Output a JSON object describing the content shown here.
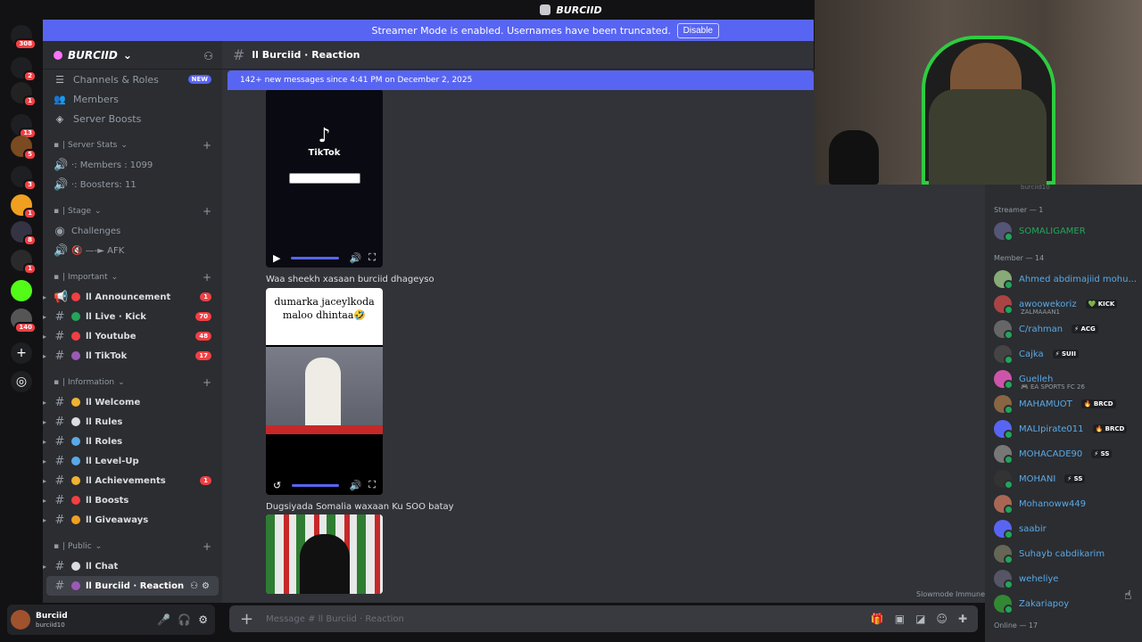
{
  "window": {
    "title": "BURCIID"
  },
  "rail": {
    "items": [
      {
        "badge": "308",
        "color": "#1e1f22"
      },
      {
        "badge": "2",
        "color": "#1e1f22"
      },
      {
        "badge": "1",
        "color": "#222"
      },
      {
        "badge": "13",
        "color": "#1e1f22"
      },
      {
        "badge": "5",
        "color": "#7a4a20"
      },
      {
        "badge": "3",
        "color": "#1e1f22"
      },
      {
        "badge": "1",
        "color": "#f0a020"
      },
      {
        "badge": "8",
        "color": "#334"
      },
      {
        "badge": "1",
        "color": "#2a2a2a"
      },
      {
        "badge": "",
        "color": "#53fc18"
      },
      {
        "badge": "140",
        "color": "#555"
      }
    ]
  },
  "banner": {
    "text": "Streamer Mode is enabled. Usernames have been truncated.",
    "button": "Disable"
  },
  "server": {
    "name": "BURCIID"
  },
  "nav": [
    {
      "icon": "channels-roles-icon",
      "glyph": "☰",
      "label": "Channels & Roles",
      "badge": "NEW"
    },
    {
      "icon": "members-icon",
      "glyph": "👥",
      "label": "Members",
      "badge": ""
    },
    {
      "icon": "server-boosts-icon",
      "glyph": "◈",
      "label": "Server Boosts",
      "badge": ""
    }
  ],
  "categories": [
    {
      "label": "| Server Stats",
      "channels": [
        {
          "type": "voice",
          "label": "·: Members : 1099",
          "badge": "",
          "dot": ""
        },
        {
          "type": "voice",
          "label": "·: Boosters: 11",
          "badge": "",
          "dot": ""
        }
      ]
    },
    {
      "label": "| Stage",
      "channels": [
        {
          "type": "stage",
          "label": "Challenges",
          "badge": "",
          "dot": ""
        },
        {
          "type": "voice",
          "label": "🔇 —-► AFK",
          "badge": "",
          "dot": ""
        }
      ]
    },
    {
      "label": "| Important",
      "channels": [
        {
          "type": "announce",
          "label": "ll Announcement",
          "badge": "1",
          "dot": "#f23f43"
        },
        {
          "type": "text",
          "label": "ll Live · Kick",
          "badge": "70",
          "dot": "#23a55a"
        },
        {
          "type": "text",
          "label": "ll Youtube",
          "badge": "48",
          "dot": "#f23f43"
        },
        {
          "type": "text",
          "label": "ll TikTok",
          "badge": "17",
          "dot": "#9b59b6"
        }
      ]
    },
    {
      "label": "| Information",
      "channels": [
        {
          "type": "text",
          "label": "ll Welcome",
          "badge": "",
          "dot": "#f0b232"
        },
        {
          "type": "text",
          "label": "ll Rules",
          "badge": "",
          "dot": "#dbdee1"
        },
        {
          "type": "text",
          "label": "ll Roles",
          "badge": "",
          "dot": "#5aa9e6"
        },
        {
          "type": "text",
          "label": "ll Level-Up",
          "badge": "",
          "dot": "#5aa9e6"
        },
        {
          "type": "text",
          "label": "ll Achievements",
          "badge": "1",
          "dot": "#f0b232"
        },
        {
          "type": "text",
          "label": "ll Boosts",
          "badge": "",
          "dot": "#f23f43"
        },
        {
          "type": "text",
          "label": "ll Giveaways",
          "badge": "",
          "dot": "#f0a020"
        }
      ]
    },
    {
      "label": "| Public",
      "channels": [
        {
          "type": "text",
          "label": "ll Chat",
          "badge": "",
          "dot": "#dbdee1"
        },
        {
          "type": "text",
          "label": "ll Burciid · Reaction",
          "badge": "",
          "dot": "#9b59b6",
          "selected": true
        }
      ]
    }
  ],
  "channel": {
    "name": "ll Burciid · Reaction"
  },
  "new_messages": {
    "text": "142+ new messages since 4:41 PM on December 2, 2025"
  },
  "messages": [
    {
      "caption": "Waa sheekh xasaan burciid dhageyso"
    },
    {
      "caption": "Dugsiyada Somalia waxaan Ku SOO batay"
    }
  ],
  "tiktok": {
    "label": "TikTok"
  },
  "video2": {
    "overlay": "dumarka jaceylkoda maloo dhintaa🤣"
  },
  "slowmode": {
    "text": "Slowmode Immune"
  },
  "composer": {
    "placeholder": "Message # ll Burciid · Reaction"
  },
  "user": {
    "name": "Burciid",
    "status": "burciid10"
  },
  "member_list": {
    "top_truncated": "burciid10",
    "groups": [
      {
        "label": "Streamer — 1",
        "members": [
          {
            "name": "SOMALIGAMER",
            "tag": "",
            "sub": "",
            "color": "#23a55a",
            "avatar": "#557"
          }
        ]
      },
      {
        "label": "Member — 14",
        "members": [
          {
            "name": "Ahmed abdimajiid mohu...",
            "tag": "",
            "sub": "",
            "color": "#5aa9e6",
            "avatar": "#8a7"
          },
          {
            "name": "awoowekoriz",
            "tag": "💚 KICK",
            "sub": "ZALMAAAN1",
            "color": "#5aa9e6",
            "avatar": "#a44"
          },
          {
            "name": "C/rahman",
            "tag": "⚡ ACG",
            "sub": "",
            "color": "#5aa9e6",
            "avatar": "#666"
          },
          {
            "name": "Cajka",
            "tag": "⚡ SUII",
            "sub": "",
            "color": "#5aa9e6",
            "avatar": "#444"
          },
          {
            "name": "Guelleh",
            "tag": "",
            "sub": "🎮 EA SPORTS FC 26",
            "color": "#5aa9e6",
            "avatar": "#c5a"
          },
          {
            "name": "MAHAMUOT",
            "tag": "🔥 BRCD",
            "sub": "",
            "color": "#5aa9e6",
            "avatar": "#864"
          },
          {
            "name": "MALIpirate011",
            "tag": "🔥 BRCD",
            "sub": "",
            "color": "#5aa9e6",
            "avatar": "#5865f2"
          },
          {
            "name": "MOHACADE90",
            "tag": "⚡ SS",
            "sub": "",
            "color": "#5aa9e6",
            "avatar": "#777"
          },
          {
            "name": "MOHANI",
            "tag": "⚡ SS",
            "sub": "",
            "color": "#5aa9e6",
            "avatar": "#333"
          },
          {
            "name": "Mohanoww449",
            "tag": "",
            "sub": "",
            "color": "#5aa9e6",
            "avatar": "#a65"
          },
          {
            "name": "saabir",
            "tag": "",
            "sub": "",
            "color": "#5aa9e6",
            "avatar": "#5865f2"
          },
          {
            "name": "Suhayb cabdikarim",
            "tag": "",
            "sub": "",
            "color": "#5aa9e6",
            "avatar": "#665"
          },
          {
            "name": "weheliye",
            "tag": "",
            "sub": "",
            "color": "#5aa9e6",
            "avatar": "#556"
          },
          {
            "name": "Zakariapoy",
            "tag": "",
            "sub": "",
            "color": "#5aa9e6",
            "avatar": "#383"
          }
        ]
      }
    ],
    "online": "Online — 17"
  }
}
